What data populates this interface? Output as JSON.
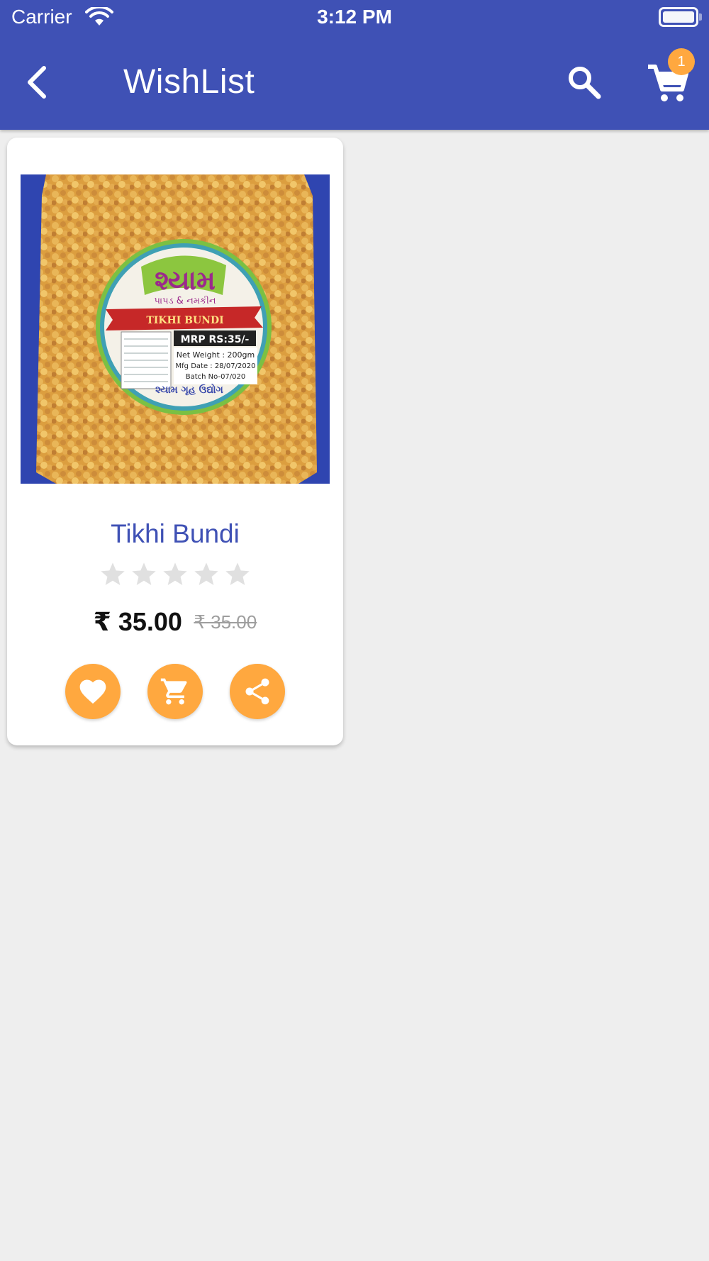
{
  "status_bar": {
    "carrier": "Carrier",
    "time": "3:12 PM"
  },
  "app_bar": {
    "title": "WishList",
    "cart_badge": "1",
    "icons": [
      "back-arrow-icon",
      "search-icon",
      "cart-icon"
    ]
  },
  "products": [
    {
      "name": "Tikhi Bundi",
      "rating": 0,
      "rating_max": 5,
      "price": "₹ 35.00",
      "original_price": "₹ 35.00",
      "image_label": {
        "brand": "શ્યામ",
        "subtitle": "પાપડ & નમકીન",
        "ribbon": "TIKHI BUNDI",
        "mrp": "MRP RS:35/-",
        "net_weight": "Net Weight : 200gm",
        "mfg_date": "Mfg Date : 28/07/2020",
        "batch": "Batch No-07/020",
        "footer": "શ્યામ ગૃહ ઉદ્યોગ"
      },
      "actions": [
        "heart-icon",
        "add-to-cart-icon",
        "share-icon"
      ]
    }
  ],
  "colors": {
    "primary": "#3f51b5",
    "accent": "#ffa83f",
    "background": "#eeeeee",
    "star_empty": "#e0e0e0"
  }
}
